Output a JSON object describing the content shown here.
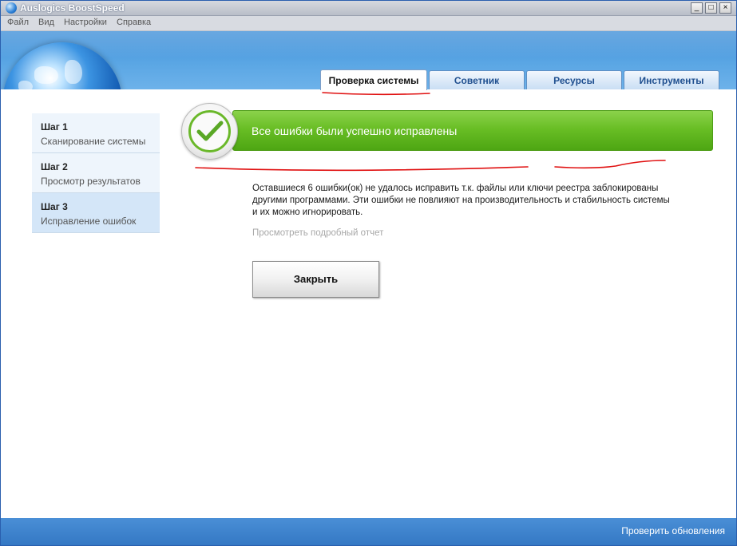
{
  "window": {
    "title": "Auslogics BoostSpeed",
    "min_glyph": "_",
    "max_glyph": "□",
    "close_glyph": "×"
  },
  "menu": {
    "items": [
      "Файл",
      "Вид",
      "Настройки",
      "Справка"
    ]
  },
  "tabs": [
    {
      "label": "Проверка системы",
      "active": true
    },
    {
      "label": "Советник",
      "active": false
    },
    {
      "label": "Ресурсы",
      "active": false
    },
    {
      "label": "Инструменты",
      "active": false
    }
  ],
  "steps": [
    {
      "title": "Шаг 1",
      "desc": "Сканирование системы",
      "current": false
    },
    {
      "title": "Шаг 2",
      "desc": "Просмотр результатов",
      "current": false
    },
    {
      "title": "Шаг 3",
      "desc": "Исправление ошибок",
      "current": true
    }
  ],
  "banner": {
    "text": "Все ошибки были успешно исправлены",
    "icon": "checkmark-icon"
  },
  "message": {
    "line1": "Оставшиеся 6 ошибки(ок) не удалось исправить т.к. файлы или ключи реестра заблокированы",
    "line2": "другими программами. Эти ошибки не повлияют на производительность и стабильность системы",
    "line3": "и их можно игнорировать."
  },
  "detail_link": "Просмотреть подробный отчет",
  "close_button": "Закрыть",
  "footer": {
    "update_link": "Проверить обновления"
  },
  "colors": {
    "accent_blue": "#3f8fd8",
    "success_green": "#69be25",
    "annotation_red": "#e01010"
  }
}
